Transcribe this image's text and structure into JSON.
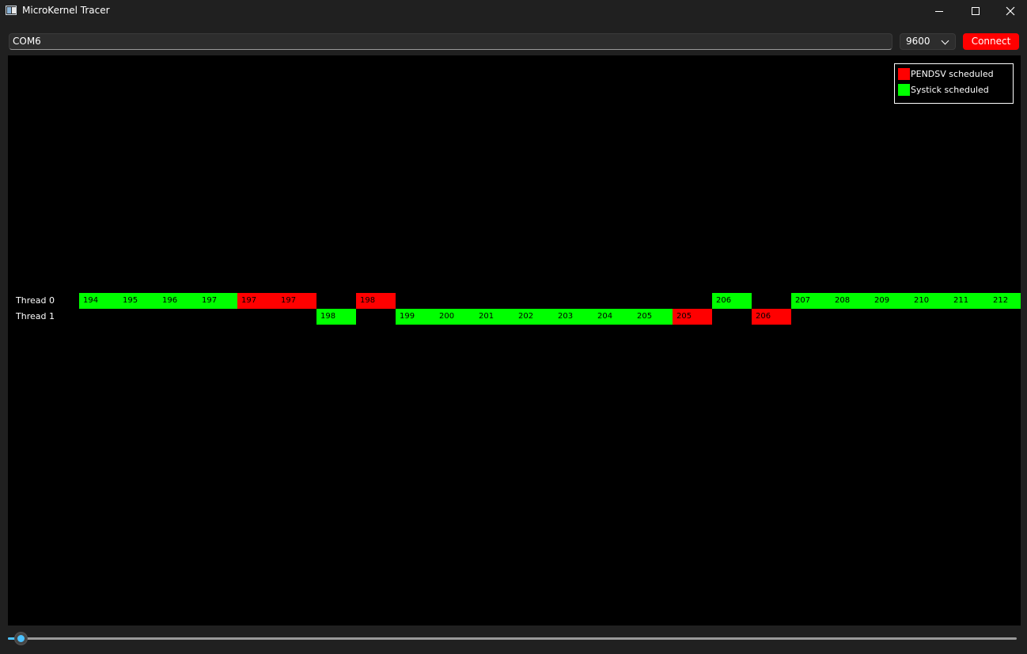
{
  "window": {
    "title": "MicroKernel Tracer",
    "controls": [
      "minimize-icon",
      "maximize-icon",
      "close-icon"
    ]
  },
  "toolbar": {
    "port_value": "COM6",
    "baud_value": "9600",
    "connect_label": "Connect",
    "connect_color": "#ff0000"
  },
  "legend": {
    "items": [
      {
        "label": "PENDSV scheduled",
        "color": "#ff0000"
      },
      {
        "label": "Systick scheduled",
        "color": "#00ff00"
      }
    ]
  },
  "threads": [
    {
      "label": "Thread 0"
    },
    {
      "label": "Thread 1"
    }
  ],
  "trace": [
    {
      "thread": 0,
      "slot": 0,
      "tick": "194",
      "event": "systick"
    },
    {
      "thread": 0,
      "slot": 1,
      "tick": "195",
      "event": "systick"
    },
    {
      "thread": 0,
      "slot": 2,
      "tick": "196",
      "event": "systick"
    },
    {
      "thread": 0,
      "slot": 3,
      "tick": "197",
      "event": "systick"
    },
    {
      "thread": 0,
      "slot": 4,
      "tick": "197",
      "event": "pendsv"
    },
    {
      "thread": 0,
      "slot": 5,
      "tick": "197",
      "event": "pendsv"
    },
    {
      "thread": 1,
      "slot": 6,
      "tick": "198",
      "event": "systick"
    },
    {
      "thread": 0,
      "slot": 7,
      "tick": "198",
      "event": "pendsv"
    },
    {
      "thread": 1,
      "slot": 8,
      "tick": "199",
      "event": "systick"
    },
    {
      "thread": 1,
      "slot": 9,
      "tick": "200",
      "event": "systick"
    },
    {
      "thread": 1,
      "slot": 10,
      "tick": "201",
      "event": "systick"
    },
    {
      "thread": 1,
      "slot": 11,
      "tick": "202",
      "event": "systick"
    },
    {
      "thread": 1,
      "slot": 12,
      "tick": "203",
      "event": "systick"
    },
    {
      "thread": 1,
      "slot": 13,
      "tick": "204",
      "event": "systick"
    },
    {
      "thread": 1,
      "slot": 14,
      "tick": "205",
      "event": "systick"
    },
    {
      "thread": 1,
      "slot": 15,
      "tick": "205",
      "event": "pendsv"
    },
    {
      "thread": 0,
      "slot": 16,
      "tick": "206",
      "event": "systick"
    },
    {
      "thread": 1,
      "slot": 17,
      "tick": "206",
      "event": "pendsv"
    },
    {
      "thread": 0,
      "slot": 18,
      "tick": "207",
      "event": "systick"
    },
    {
      "thread": 0,
      "slot": 19,
      "tick": "208",
      "event": "systick"
    },
    {
      "thread": 0,
      "slot": 20,
      "tick": "209",
      "event": "systick"
    },
    {
      "thread": 0,
      "slot": 21,
      "tick": "210",
      "event": "systick"
    },
    {
      "thread": 0,
      "slot": 22,
      "tick": "211",
      "event": "systick"
    },
    {
      "thread": 0,
      "slot": 23,
      "tick": "212",
      "event": "systick"
    }
  ],
  "colors": {
    "systick": "#00ff00",
    "pendsv": "#ff0000",
    "accent": "#4cc2ff"
  },
  "timeline": {
    "position": 0.01
  }
}
